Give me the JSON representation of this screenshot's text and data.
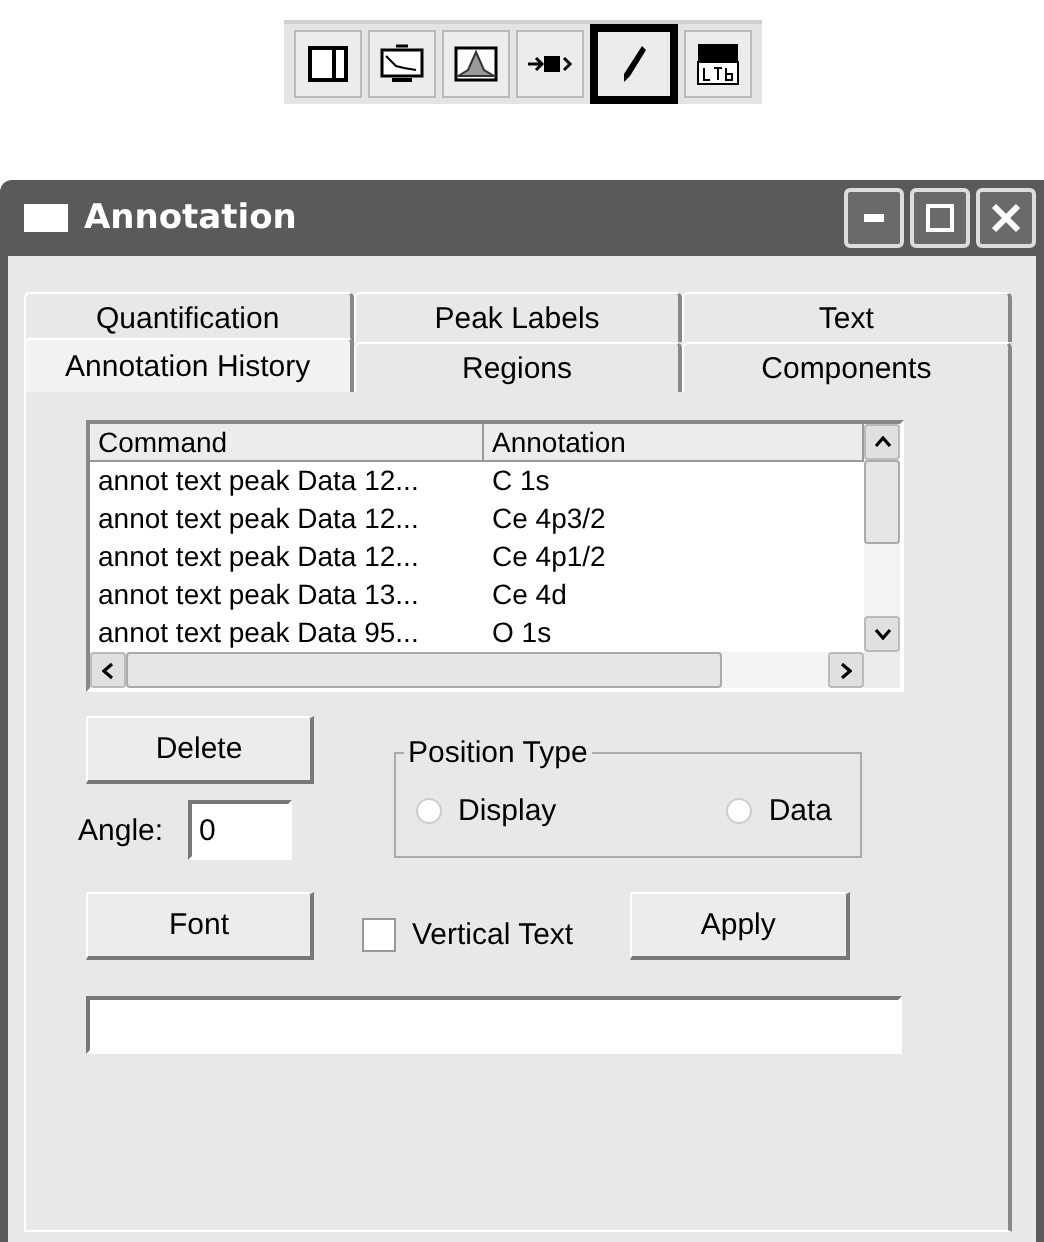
{
  "toolbar": {
    "items": [
      {
        "selected": false
      },
      {
        "selected": false
      },
      {
        "selected": false
      },
      {
        "selected": false
      },
      {
        "selected": true
      },
      {
        "selected": false
      }
    ]
  },
  "window": {
    "title": "Annotation"
  },
  "tabs": [
    [
      {
        "label": "Quantification",
        "selected": false
      },
      {
        "label": "Peak Labels",
        "selected": false
      },
      {
        "label": "Text",
        "selected": false
      }
    ],
    [
      {
        "label": "Annotation History",
        "selected": true
      },
      {
        "label": "Regions",
        "selected": false
      },
      {
        "label": "Components",
        "selected": false
      }
    ]
  ],
  "table": {
    "columns": [
      "Command",
      "Annotation"
    ],
    "rows": [
      [
        "annot text peak Data 12...",
        "C 1s"
      ],
      [
        "annot text peak Data 12...",
        "Ce 4p3/2"
      ],
      [
        "annot text peak Data 12...",
        "Ce 4p1/2"
      ],
      [
        "annot text peak Data 13...",
        "Ce 4d"
      ],
      [
        "annot text peak Data 95...",
        "O 1s"
      ]
    ]
  },
  "delete_button": "Delete",
  "angle": {
    "label": "Angle:",
    "value": "0"
  },
  "position_type": {
    "title": "Position Type",
    "options": [
      {
        "label": "Display",
        "selected": false
      },
      {
        "label": "Data",
        "selected": false
      }
    ]
  },
  "font_button": "Font",
  "vertical_text": {
    "label": "Vertical Text",
    "checked": false
  },
  "apply_button": "Apply"
}
